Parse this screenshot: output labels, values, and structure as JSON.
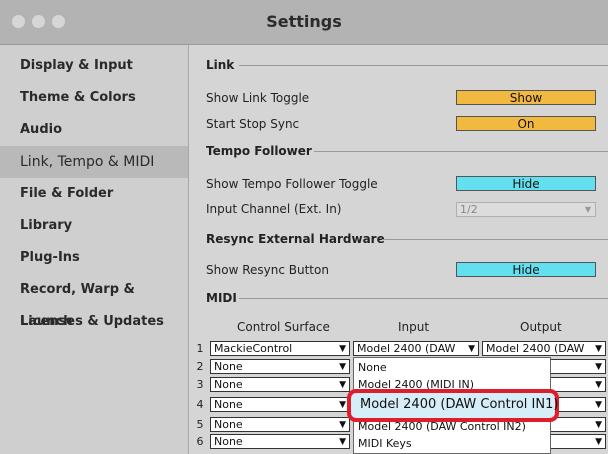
{
  "window": {
    "title": "Settings"
  },
  "sidebar": {
    "items": [
      {
        "label": "Display & Input"
      },
      {
        "label": "Theme & Colors"
      },
      {
        "label": "Audio"
      },
      {
        "label": "Link, Tempo & MIDI",
        "active": true
      },
      {
        "label": "File & Folder"
      },
      {
        "label": "Library"
      },
      {
        "label": "Plug-Ins"
      },
      {
        "label": "Record, Warp & Launch"
      },
      {
        "label": "Licenses & Updates"
      }
    ]
  },
  "link": {
    "heading": "Link",
    "show_link_toggle_label": "Show Link Toggle",
    "show_link_toggle_value": "Show",
    "start_stop_sync_label": "Start Stop Sync",
    "start_stop_sync_value": "On"
  },
  "tempo_follower": {
    "heading": "Tempo Follower",
    "show_toggle_label": "Show Tempo Follower Toggle",
    "show_toggle_value": "Hide",
    "input_channel_label": "Input Channel (Ext. In)",
    "input_channel_value": "1/2"
  },
  "resync": {
    "heading": "Resync External Hardware",
    "show_button_label": "Show Resync Button",
    "show_button_value": "Hide"
  },
  "midi": {
    "heading": "MIDI",
    "columns": [
      "Control Surface",
      "Input",
      "Output"
    ],
    "rows": [
      {
        "num": "1",
        "surface": "MackieControl",
        "input": "Model 2400 (DAW",
        "output": "Model 2400 (DAW"
      },
      {
        "num": "2",
        "surface": "None",
        "input": "",
        "output": ""
      },
      {
        "num": "3",
        "surface": "None",
        "input": "",
        "output": ""
      },
      {
        "num": "4",
        "surface": "None",
        "input": "",
        "output": ""
      },
      {
        "num": "5",
        "surface": "None",
        "input": "",
        "output": ""
      },
      {
        "num": "6",
        "surface": "None",
        "input": "",
        "output": ""
      }
    ]
  },
  "input_menu": {
    "items": [
      {
        "label": "None"
      },
      {
        "label": "Model 2400 (MIDI IN)"
      },
      {
        "label": "Model 2400 (DAW Control IN1)",
        "selected": true
      },
      {
        "label": "Model 2400 (DAW Control IN2)"
      },
      {
        "label": "MIDI Keys"
      }
    ]
  },
  "colors": {
    "orange": "#f2b941",
    "cyan": "#63e0ef",
    "highlight": "#e01d2d"
  }
}
